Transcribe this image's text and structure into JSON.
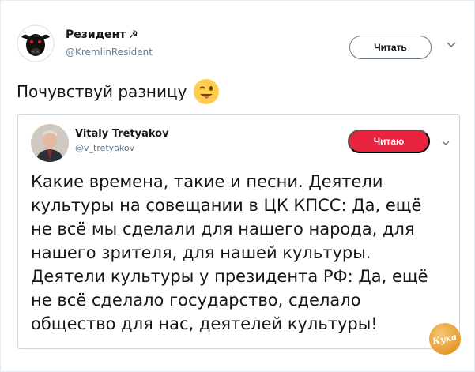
{
  "tweet": {
    "author_name": "Резидент",
    "author_symbol": "☭",
    "author_handle": "@KremlinResident",
    "follow_label": "Читать",
    "text": "Почувствуй разницу",
    "emoji": "winking-face-with-tongue"
  },
  "quoted": {
    "author_name": "Vitaly Tretyakov",
    "author_handle": "@v_tretyakov",
    "follow_label": "Читаю",
    "text": "Какие времена, такие и песни. Деятели\nкультуры на совещании в ЦК КПСС: Да, ещё\nне всё мы сделали для нашего народа, для\nнашего зрителя, для нашей культуры.\nДеятели культуры у президента РФ: Да, ещё\nне всё сделало государство, сделало\nобщество для нас, деятелей культуры!"
  },
  "watermark": {
    "text": "Кука"
  },
  "colors": {
    "follow_active": "#e8233e",
    "border": "#ccd6dd",
    "secondary_text": "#657786"
  }
}
